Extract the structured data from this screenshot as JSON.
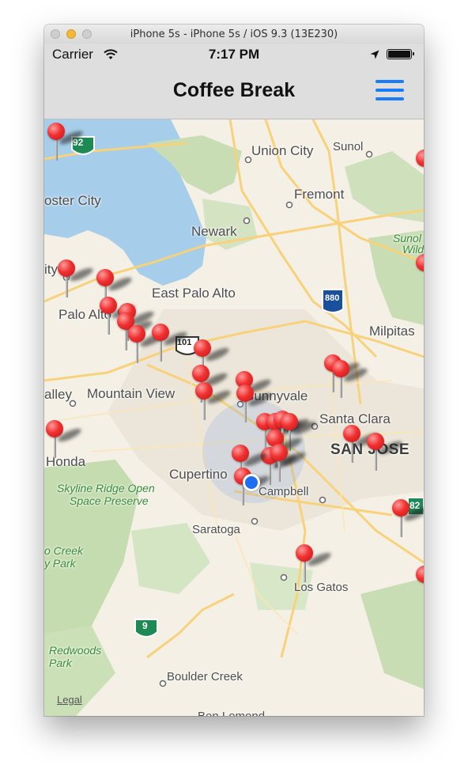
{
  "window": {
    "title": "iPhone 5s - iPhone 5s / iOS 9.3 (13E230)"
  },
  "status_bar": {
    "carrier": "Carrier",
    "time": "7:17 PM",
    "icons": [
      "wifi-icon",
      "location-arrow-icon",
      "battery-icon"
    ]
  },
  "nav_bar": {
    "title": "Coffee Break",
    "menu_icon": "hamburger-menu-icon",
    "accent_color": "#1a7cf6"
  },
  "map": {
    "legal": "Legal",
    "places": [
      "Union City",
      "Sunol",
      "Fremont",
      "oster City",
      "Newark",
      "Sunol",
      "Wild",
      "ity",
      "East Palo Alto",
      "Palo Alto",
      "Milpitas",
      "alley",
      "Mountain View",
      "Sunnyvale",
      "Santa Clara",
      "SAN JOSE",
      "Honda",
      "Cupertino",
      "Campbell",
      "Saratoga",
      "Los Gatos",
      "Boulder Creek",
      "Ben Lomond"
    ],
    "park_labels": [
      "Skyline Ridge Open",
      "Space Preserve",
      "o Creek",
      "y Park",
      "Redwoods",
      "Park"
    ],
    "highway_shields": [
      "92",
      "880",
      "101",
      "9",
      "82"
    ],
    "pin_color": "#f03030",
    "pin_count": 32
  }
}
